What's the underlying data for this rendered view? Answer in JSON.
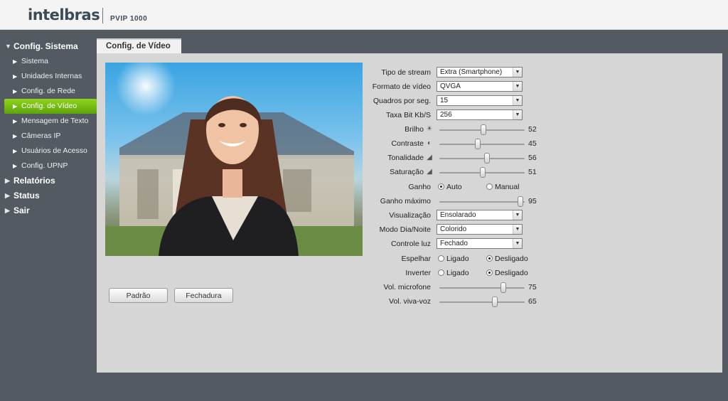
{
  "header": {
    "brand": "intelbras",
    "model": "PVIP 1000"
  },
  "sidebar": {
    "section_config": "Config. Sistema",
    "items": [
      {
        "label": "Sistema"
      },
      {
        "label": "Unidades Internas"
      },
      {
        "label": "Config. de Rede"
      },
      {
        "label": "Config. de Vídeo"
      },
      {
        "label": "Mensagem de Texto"
      },
      {
        "label": "Câmeras IP"
      },
      {
        "label": "Usuários de Acesso"
      },
      {
        "label": "Config. UPNP"
      }
    ],
    "section_reports": "Relatórios",
    "section_status": "Status",
    "section_exit": "Sair",
    "accent_color": "#7cc416"
  },
  "tab": {
    "title": "Config. de Vídeo"
  },
  "buttons": {
    "default": "Padrão",
    "lock": "Fechadura"
  },
  "form": {
    "stream_type": {
      "label": "Tipo de stream",
      "value": "Extra (Smartphone)"
    },
    "video_format": {
      "label": "Formato de vídeo",
      "value": "QVGA"
    },
    "fps": {
      "label": "Quadros por seg.",
      "value": "15"
    },
    "bitrate": {
      "label": "Taxa Bit Kb/S",
      "value": "256"
    },
    "brightness": {
      "label": "Brilho",
      "value": "52",
      "icon": "sun-icon",
      "level": 52
    },
    "contrast": {
      "label": "Contraste",
      "value": "45",
      "icon": "contrast-icon",
      "level": 45
    },
    "hue": {
      "label": "Tonalidade",
      "value": "56",
      "icon": "hue-icon",
      "level": 56
    },
    "saturation": {
      "label": "Saturação",
      "value": "51",
      "icon": "saturation-icon",
      "level": 51
    },
    "gain": {
      "label": "Ganho",
      "option_auto": "Auto",
      "option_manual": "Manual",
      "selected": "Auto"
    },
    "max_gain": {
      "label": "Ganho máximo",
      "value": "95",
      "level": 95
    },
    "view": {
      "label": "Visualização",
      "value": "Ensolarado"
    },
    "day_night": {
      "label": "Modo Dia/Noite",
      "value": "Colorido"
    },
    "light_control": {
      "label": "Controle luz",
      "value": "Fechado"
    },
    "mirror": {
      "label": "Espelhar",
      "option_on": "Ligado",
      "option_off": "Desligado",
      "selected": "Desligado"
    },
    "invert": {
      "label": "Inverter",
      "option_on": "Ligado",
      "option_off": "Desligado",
      "selected": "Desligado"
    },
    "mic_volume": {
      "label": "Vol. microfone",
      "value": "75",
      "level": 75
    },
    "speaker_volume": {
      "label": "Vol. viva-voz",
      "value": "65",
      "level": 65
    }
  }
}
